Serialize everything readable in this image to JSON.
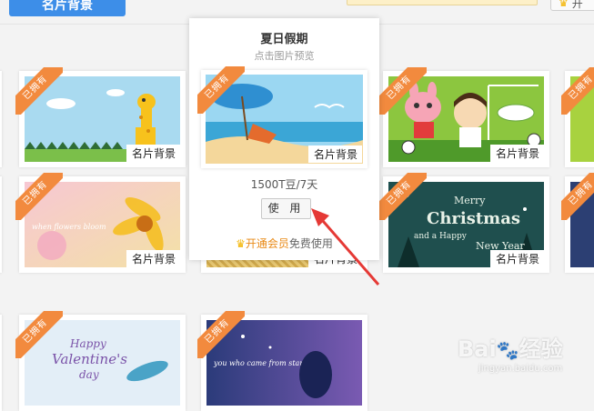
{
  "header": {
    "primary_button": "名片背景",
    "right_button": "开",
    "crown_icon": "crown-icon"
  },
  "badge_text": "已拥有",
  "card_label": "名片背景",
  "popup": {
    "title": "夏日假期",
    "subtitle": "点击图片预览",
    "price": "1500T豆/7天",
    "use_button": "使 用",
    "vip_link": "开通会员",
    "vip_suffix": "免费使用"
  },
  "thumbnails": {
    "christmas_line1": "Merry",
    "christmas_line2": "Christmas",
    "christmas_line3": "and a Happy",
    "christmas_line4": "New Year",
    "valentine_line1": "Happy",
    "valentine_line2": "Valentine's",
    "valentine_line3": "day",
    "flowers_text": "when flowers bloom",
    "star_text": "you who came from star"
  },
  "watermark": {
    "brand": "Bai",
    "brand_suffix": "经验",
    "url": "jingyan.baidu.com"
  },
  "colors": {
    "ribbon": "#f28a3e",
    "primary": "#3d8ee8",
    "vip": "#e98a17",
    "arrow": "#e53935"
  }
}
